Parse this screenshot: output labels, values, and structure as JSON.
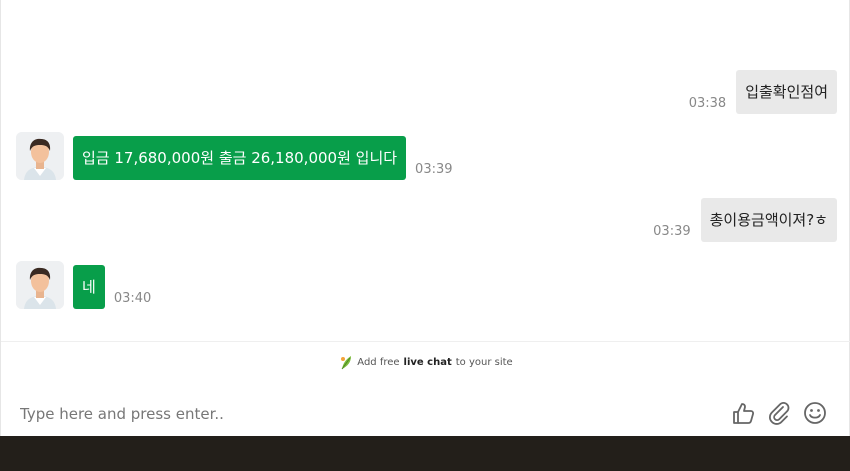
{
  "messages": [
    {
      "sender": "visitor",
      "text": "입출확인점여",
      "time": "03:38"
    },
    {
      "sender": "agent",
      "text": "입금 17,680,000원 출금 26,180,000원 입니다",
      "time": "03:39"
    },
    {
      "sender": "visitor",
      "text": "총이용금액이져?ㅎ",
      "time": "03:39"
    },
    {
      "sender": "agent",
      "text": "네",
      "time": "03:40"
    }
  ],
  "promo": {
    "prefix": "Add free",
    "highlight": "live chat",
    "suffix": "to your site"
  },
  "composer": {
    "placeholder": "Type here and press enter.."
  },
  "icons": {
    "avatar": "agent-avatar",
    "promo": "leaf-icon",
    "like": "thumbs-up-icon",
    "attach": "paperclip-icon",
    "emoji": "smiley-icon"
  },
  "colors": {
    "agent_bubble": "#089e4a",
    "visitor_bubble": "#e9e9e9",
    "taskbar": "#231f1a"
  }
}
